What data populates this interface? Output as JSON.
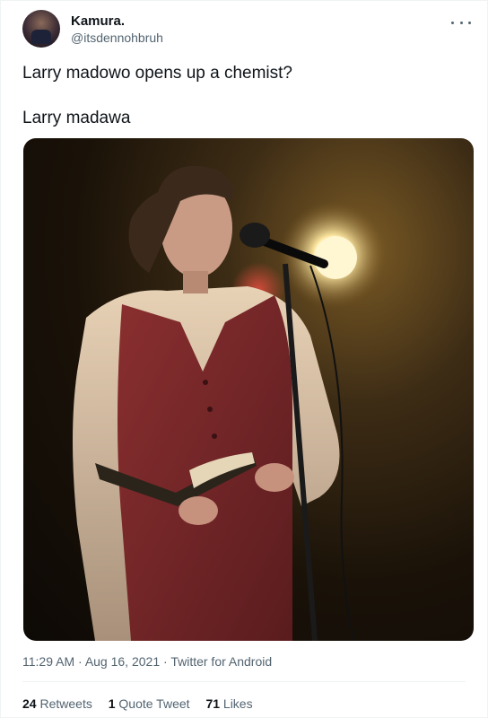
{
  "author": {
    "name": "Kamura.",
    "handle": "@itsdennohbruh"
  },
  "tweet": {
    "line1": "Larry madowo opens up a chemist?",
    "line2": "Larry madawa"
  },
  "meta": {
    "time": "11:29 AM",
    "date": "Aug 16, 2021",
    "source": "Twitter for Android",
    "separator": "·"
  },
  "stats": {
    "retweets": {
      "count": "24",
      "label": "Retweets"
    },
    "quotes": {
      "count": "1",
      "label": "Quote Tweet"
    },
    "likes": {
      "count": "71",
      "label": "Likes"
    }
  },
  "icons": {
    "more": "more-horizontal-icon"
  },
  "colors": {
    "text": "#0f1419",
    "secondary": "#536471",
    "divider": "#eff3f4"
  }
}
